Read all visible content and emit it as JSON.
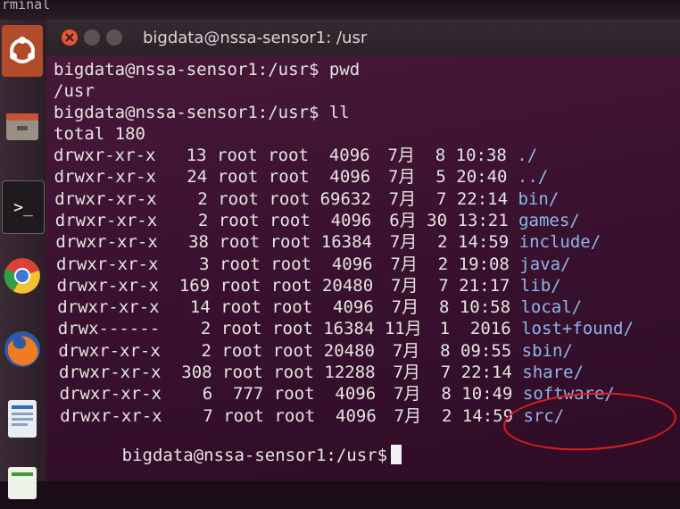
{
  "top_label": "rminal",
  "window": {
    "title": "bigdata@nssa-sensor1: /usr"
  },
  "launcher": [
    {
      "icon": "ubuntu-dash-icon"
    },
    {
      "icon": "files-icon"
    },
    {
      "icon": "terminal-icon",
      "glyph": ">_"
    },
    {
      "icon": "chrome-icon"
    },
    {
      "icon": "firefox-icon"
    },
    {
      "icon": "document-viewer-icon"
    },
    {
      "icon": "spreadsheet-icon"
    }
  ],
  "session": {
    "cmd1": "bigdata@nssa-sensor1:/usr$ pwd",
    "out1": "/usr",
    "cmd2": "bigdata@nssa-sensor1:/usr$ ll",
    "total": "total 180",
    "rows": [
      {
        "perm": "drwxr-xr-x",
        "links": "13",
        "owner": "root",
        "group": "root",
        "size": "4096",
        "month": "7月",
        "day": "8",
        "time": "10:38",
        "name": "./"
      },
      {
        "perm": "drwxr-xr-x",
        "links": "24",
        "owner": "root",
        "group": "root",
        "size": "4096",
        "month": "7月",
        "day": "5",
        "time": "20:40",
        "name": "../"
      },
      {
        "perm": "drwxr-xr-x",
        "links": "2",
        "owner": "root",
        "group": "root",
        "size": "69632",
        "month": "7月",
        "day": "7",
        "time": "22:14",
        "name": "bin/"
      },
      {
        "perm": "drwxr-xr-x",
        "links": "2",
        "owner": "root",
        "group": "root",
        "size": "4096",
        "month": "6月",
        "day": "30",
        "time": "13:21",
        "name": "games/"
      },
      {
        "perm": "drwxr-xr-x",
        "links": "38",
        "owner": "root",
        "group": "root",
        "size": "16384",
        "month": "7月",
        "day": "2",
        "time": "14:59",
        "name": "include/"
      },
      {
        "perm": "drwxr-xr-x",
        "links": "3",
        "owner": "root",
        "group": "root",
        "size": "4096",
        "month": "7月",
        "day": "2",
        "time": "19:08",
        "name": "java/"
      },
      {
        "perm": "drwxr-xr-x",
        "links": "169",
        "owner": "root",
        "group": "root",
        "size": "20480",
        "month": "7月",
        "day": "7",
        "time": "21:17",
        "name": "lib/"
      },
      {
        "perm": "drwxr-xr-x",
        "links": "14",
        "owner": "root",
        "group": "root",
        "size": "4096",
        "month": "7月",
        "day": "8",
        "time": "10:58",
        "name": "local/"
      },
      {
        "perm": "drwx------",
        "links": "2",
        "owner": "root",
        "group": "root",
        "size": "16384",
        "month": "11月",
        "day": "1",
        "time": "2016",
        "name": "lost+found/"
      },
      {
        "perm": "drwxr-xr-x",
        "links": "2",
        "owner": "root",
        "group": "root",
        "size": "20480",
        "month": "7月",
        "day": "8",
        "time": "09:55",
        "name": "sbin/"
      },
      {
        "perm": "drwxr-xr-x",
        "links": "308",
        "owner": "root",
        "group": "root",
        "size": "12288",
        "month": "7月",
        "day": "7",
        "time": "22:14",
        "name": "share/"
      },
      {
        "perm": "drwxr-xr-x",
        "links": "6",
        "owner": "777",
        "group": "root",
        "size": "4096",
        "month": "7月",
        "day": "8",
        "time": "10:49",
        "name": "software/"
      },
      {
        "perm": "drwxr-xr-x",
        "links": "7",
        "owner": "root",
        "group": "root",
        "size": "4096",
        "month": "7月",
        "day": "2",
        "time": "14:59",
        "name": "src/"
      }
    ],
    "final_prompt": "bigdata@nssa-sensor1:/usr$"
  },
  "colors": {
    "directory": "#8fb6ec",
    "text": "#e6e4e2",
    "annotation": "#e01e1e"
  }
}
